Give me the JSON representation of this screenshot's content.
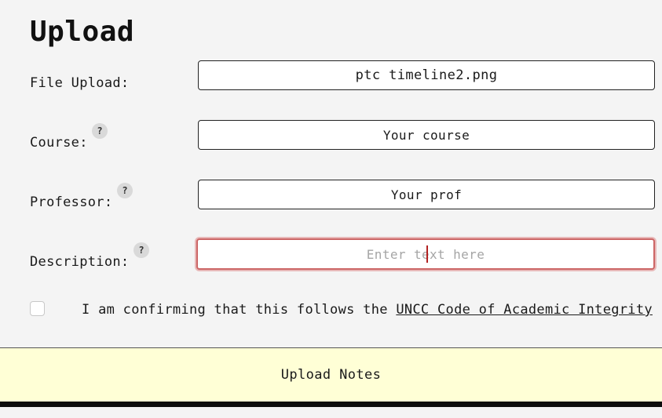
{
  "page": {
    "title": "Upload"
  },
  "form": {
    "file_upload": {
      "label": "File Upload:",
      "value": "ptc timeline2.png"
    },
    "course": {
      "label": "Course:",
      "help": "?",
      "value": "Your course"
    },
    "professor": {
      "label": "Professor:",
      "help": "?",
      "value": "Your prof"
    },
    "description": {
      "label": "Description:",
      "help": "?",
      "placeholder": "Enter text here",
      "placeholder_before_caret": "Enter te",
      "placeholder_after_caret": "xt here",
      "value": ""
    },
    "confirmation": {
      "checked": false,
      "text": "I am confirming that this follows the ",
      "link_text": "UNCC Code of Academic Integrity"
    },
    "submit_label": "Upload Notes"
  },
  "colors": {
    "background": "#f4f4f4",
    "button_background": "#ffffd6",
    "focus_border": "#cc6666",
    "caret": "#b22222"
  },
  "icons": {
    "help": "question-mark-icon"
  }
}
